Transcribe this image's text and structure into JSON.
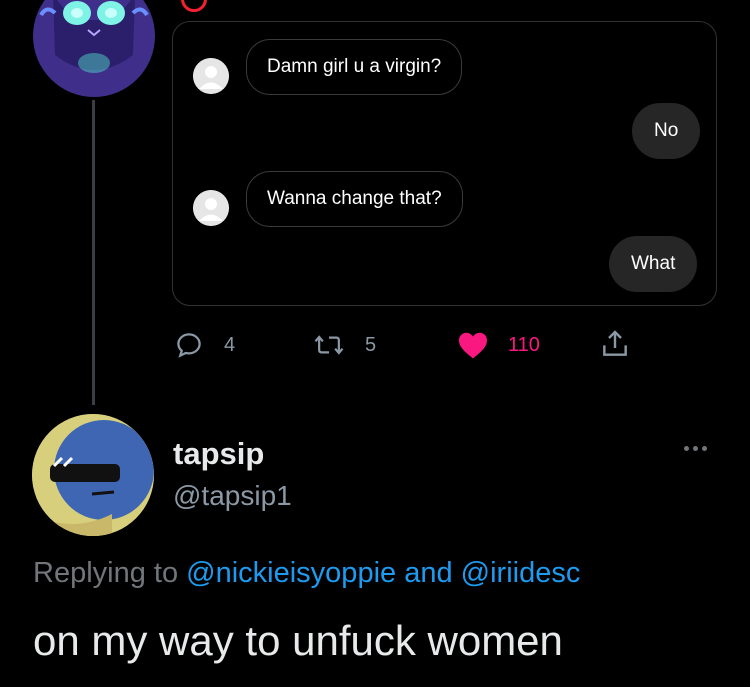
{
  "quoted_dm_card": {
    "messages": [
      {
        "side": "left",
        "text": "Damn girl u a virgin?"
      },
      {
        "side": "right",
        "text": "No"
      },
      {
        "side": "left",
        "text": "Wanna change that?"
      },
      {
        "side": "right",
        "text": "What"
      }
    ]
  },
  "actions": {
    "replies": "4",
    "retweets": "5",
    "likes": "110",
    "like_color": "#f91880"
  },
  "reply": {
    "display_name": "tapsip",
    "handle": "@tapsip1",
    "replying_prefix": "Replying to",
    "replying_user1": "@nickieisyoppie",
    "replying_joiner": "and",
    "replying_user2": "@iriidesc",
    "text": "on my way to unfuck women"
  },
  "colors": {
    "background": "#000000",
    "mention": "#1d9bf0",
    "muted": "#71767b"
  }
}
